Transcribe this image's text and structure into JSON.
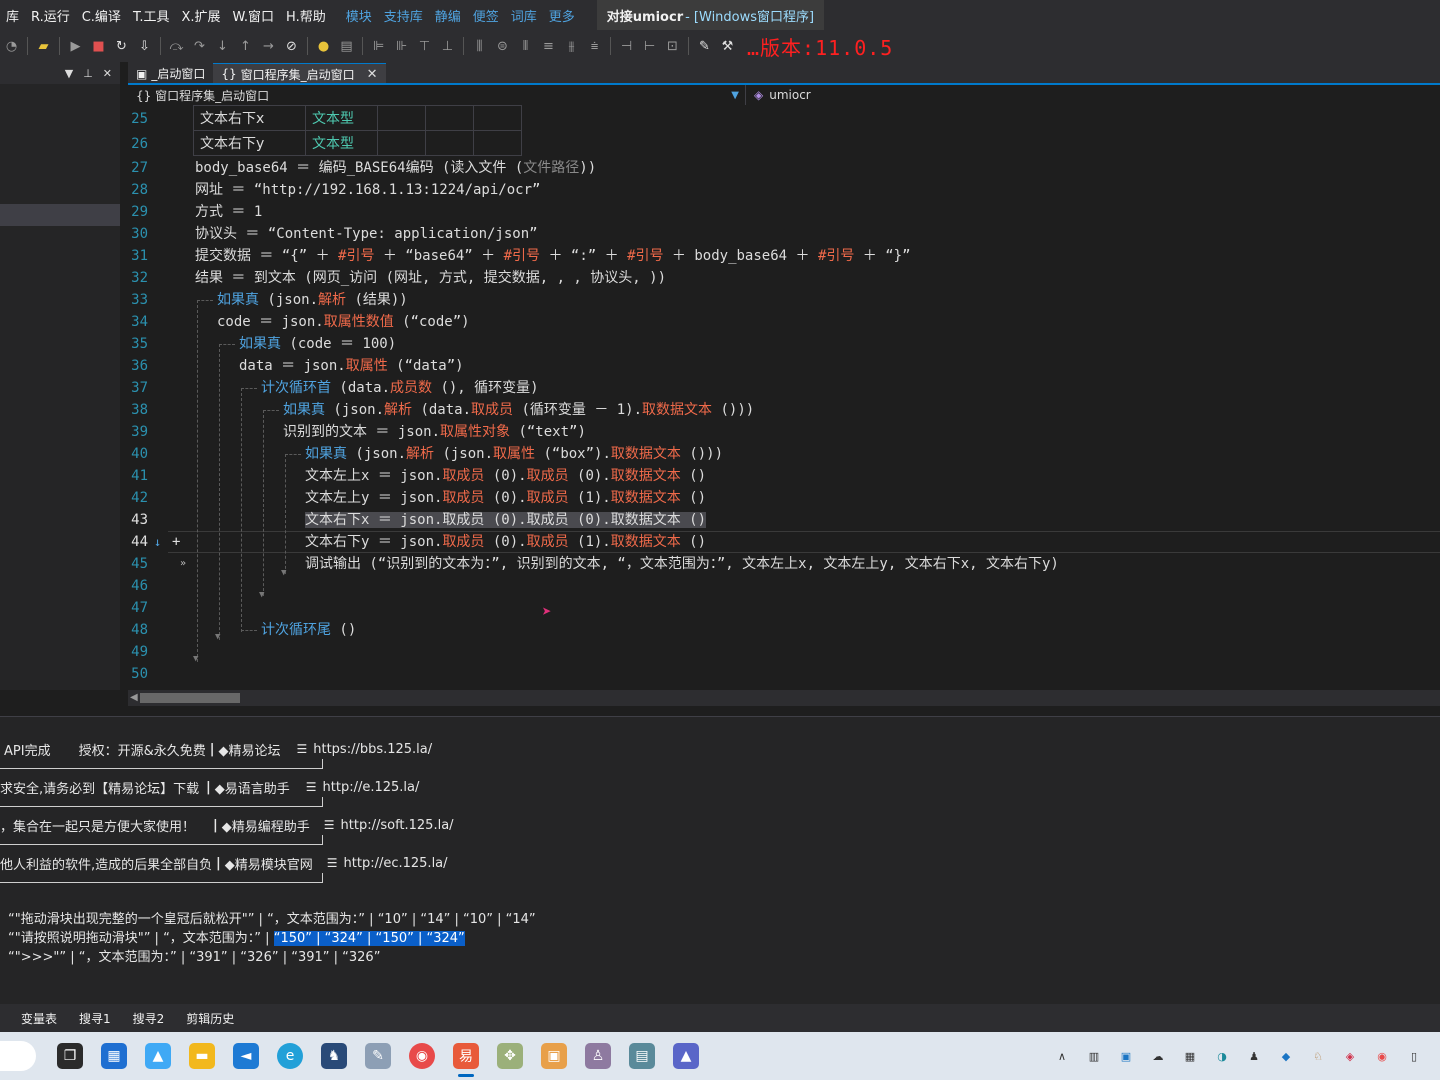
{
  "menubar": {
    "items": [
      "库",
      "R.运行",
      "C.编译",
      "T.工具",
      "X.扩展",
      "W.窗口",
      "H.帮助"
    ],
    "links": [
      "模块",
      "支持库",
      "静编",
      "便签",
      "词库",
      "更多"
    ],
    "window_title_main": "对接umiocr",
    "window_title_sub": " - [Windows窗口程序]"
  },
  "toolbar": {
    "version_text": "…版本:11.0.5"
  },
  "tabs": [
    {
      "icon": "▣",
      "label": "_启动窗口",
      "active": false
    },
    {
      "icon": "{}",
      "label": "窗口程序集_启动窗口",
      "active": true,
      "close": "✕"
    }
  ],
  "navbar": {
    "left_label": "{} 窗口程序集_启动窗口",
    "right_icon": "◈",
    "right_label": "umiocr"
  },
  "editor": {
    "var_table": [
      {
        "name": "文本右下x",
        "type": "文本型"
      },
      {
        "name": "文本右下y",
        "type": "文本型"
      }
    ],
    "line_numbers": [
      "25",
      "26",
      "27",
      "28",
      "29",
      "30",
      "31",
      "32",
      "33",
      "34",
      "35",
      "36",
      "37",
      "38",
      "39",
      "40",
      "41",
      "42",
      "43",
      "44",
      "45",
      "46",
      "47",
      "48",
      "49",
      "50"
    ],
    "current_line": "44",
    "breakpoint_marker": "+"
  },
  "output": {
    "rows": [
      {
        "left": "API完成",
        "mid": "授权：开源&永久免费",
        "site": "◆精易论坛",
        "url": "https://bbs.125.la/"
      },
      {
        "left": "求安全,请务必到【精易论坛】下载",
        "mid": "",
        "site": "◆易语言助手",
        "url": "http://e.125.la/"
      },
      {
        "left": "，集合在一起只是方便大家使用！",
        "mid": "",
        "site": "◆精易编程助手",
        "url": "http://soft.125.la/"
      },
      {
        "left": "他人利益的软件,造成的后果全部自负",
        "mid": "",
        "site": "◆精易模块官网",
        "url": "http://ec.125.la/"
      }
    ],
    "debug": [
      {
        "text": "“\"拖动滑块出现完整的一个皇冠后就松开\"” | “，文本范围为：” | “10” | “14” | “10” | “14”",
        "sel": ""
      },
      {
        "text": "“\"请按照说明拖动滑块\"” | “，文本范围为：” | ",
        "sel": "“150” | “324” | “150” | “324”"
      },
      {
        "text": "“\">>>\"” | “，文本范围为：” | “391” | “326” | “391” | “326”",
        "sel": ""
      }
    ]
  },
  "bottom_tabs": [
    "变量表",
    "搜寻1",
    "搜寻2",
    "剪辑历史"
  ]
}
